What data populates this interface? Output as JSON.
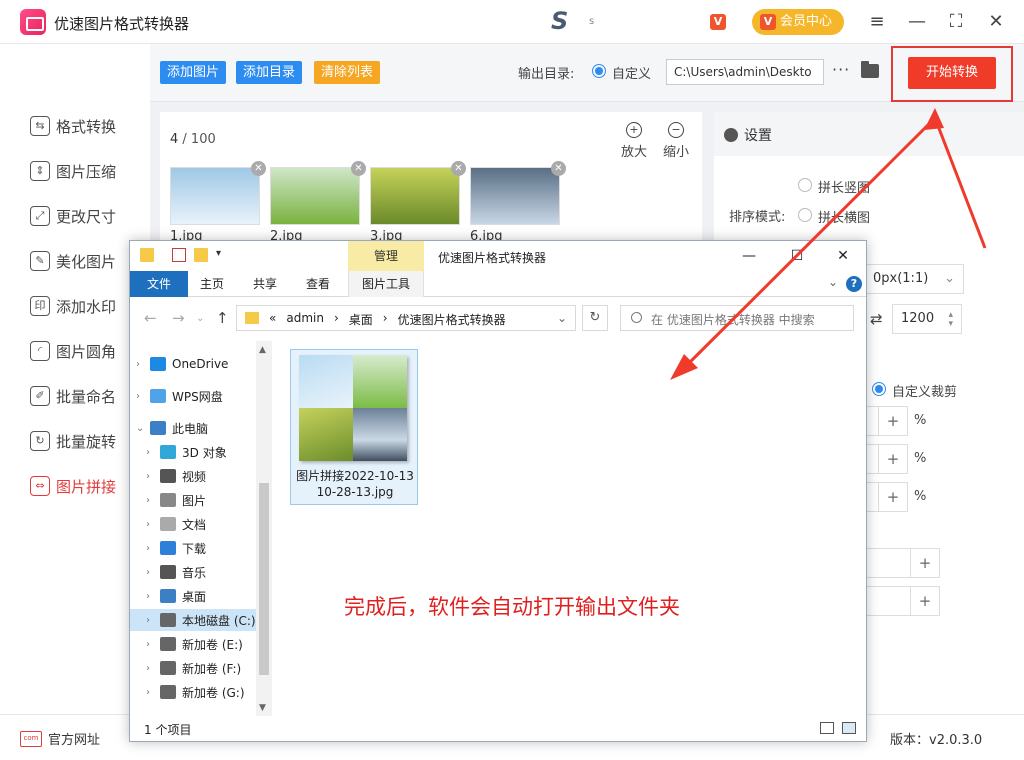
{
  "app": {
    "title": "优速图片格式转换器",
    "vip_badge": "V",
    "vip_center": "会员中心",
    "brand_dot": "s"
  },
  "sidebar": {
    "items": [
      {
        "label": "格式转换",
        "icon": "format-convert-icon",
        "glyph": "⇆"
      },
      {
        "label": "图片压缩",
        "icon": "compress-icon",
        "glyph": "⇕"
      },
      {
        "label": "更改尺寸",
        "icon": "resize-icon",
        "glyph": "⤢"
      },
      {
        "label": "美化图片",
        "icon": "beautify-icon",
        "glyph": "✎"
      },
      {
        "label": "添加水印",
        "icon": "watermark-icon",
        "glyph": "印"
      },
      {
        "label": "图片圆角",
        "icon": "round-corner-icon",
        "glyph": "◜"
      },
      {
        "label": "批量命名",
        "icon": "rename-icon",
        "glyph": "✐"
      },
      {
        "label": "批量旋转",
        "icon": "rotate-icon",
        "glyph": "↻"
      },
      {
        "label": "图片拼接",
        "icon": "stitch-icon",
        "glyph": "⇔"
      }
    ],
    "active_index": 8
  },
  "toolbar": {
    "add_image": "添加图片",
    "add_folder": "添加目录",
    "clear_list": "清除列表",
    "output_label": "输出目录:",
    "custom_label": "自定义",
    "output_path": "C:\\Users\\admin\\Deskto",
    "more": "···",
    "start": "开始转换"
  },
  "list": {
    "count_current": "4",
    "count_total": "/ 100",
    "zoom_in": "放大",
    "zoom_out": "缩小",
    "files": [
      {
        "name": "1.jpg",
        "colors": [
          "#9fc8e6",
          "#e8f2fb"
        ]
      },
      {
        "name": "2.jpg",
        "colors": [
          "#cfe6c8",
          "#7ab23f"
        ]
      },
      {
        "name": "3.jpg",
        "colors": [
          "#c6d25a",
          "#6a8a2a"
        ]
      },
      {
        "name": "6.jpg",
        "colors": [
          "#5a6f85",
          "#c8d7e6"
        ]
      }
    ]
  },
  "settings": {
    "title": "设置",
    "sort_mode_label": "排序模式:",
    "option_vertical": "拼长竖图",
    "option_horizontal": "拼长横图",
    "option_custom": "自定义",
    "size_value": "0px(1:1)",
    "width_value": "1200",
    "custom_crop": "自定义裁剪",
    "percent": "%",
    "plus": "+"
  },
  "statusbar": {
    "website": "官方网址",
    "com": "com",
    "version": "版本：v2.0.3.0"
  },
  "explorer": {
    "manage": "管理",
    "title": "优速图片格式转换器",
    "ribbon": {
      "file": "文件",
      "home": "主页",
      "share": "共享",
      "view": "查看",
      "picture_tools": "图片工具"
    },
    "address": [
      "«",
      "admin",
      "›",
      "桌面",
      "›",
      "优速图片格式转换器"
    ],
    "search_placeholder": "在 优速图片格式转换器 中搜索",
    "nav": [
      {
        "label": "OneDrive",
        "indent": 0,
        "color": "#1e88e5"
      },
      {
        "label": "WPS网盘",
        "indent": 0,
        "color": "#4fa3e8"
      },
      {
        "label": "此电脑",
        "indent": 0,
        "color": "#3d7fc5"
      },
      {
        "label": "3D 对象",
        "indent": 1,
        "color": "#32a8d8"
      },
      {
        "label": "视频",
        "indent": 1,
        "color": "#555"
      },
      {
        "label": "图片",
        "indent": 1,
        "color": "#888"
      },
      {
        "label": "文档",
        "indent": 1,
        "color": "#aaa"
      },
      {
        "label": "下载",
        "indent": 1,
        "color": "#2d7fd8"
      },
      {
        "label": "音乐",
        "indent": 1,
        "color": "#555"
      },
      {
        "label": "桌面",
        "indent": 1,
        "color": "#3d7fc5"
      },
      {
        "label": "本地磁盘 (C:)",
        "indent": 1,
        "color": "#666"
      },
      {
        "label": "新加卷 (E:)",
        "indent": 1,
        "color": "#666"
      },
      {
        "label": "新加卷 (F:)",
        "indent": 1,
        "color": "#666"
      },
      {
        "label": "新加卷 (G:)",
        "indent": 1,
        "color": "#666"
      }
    ],
    "file_name": "图片拼接2022-10-13 10-28-13.jpg",
    "annotation": "完成后，软件会自动打开输出文件夹",
    "status": "1 个项目"
  }
}
